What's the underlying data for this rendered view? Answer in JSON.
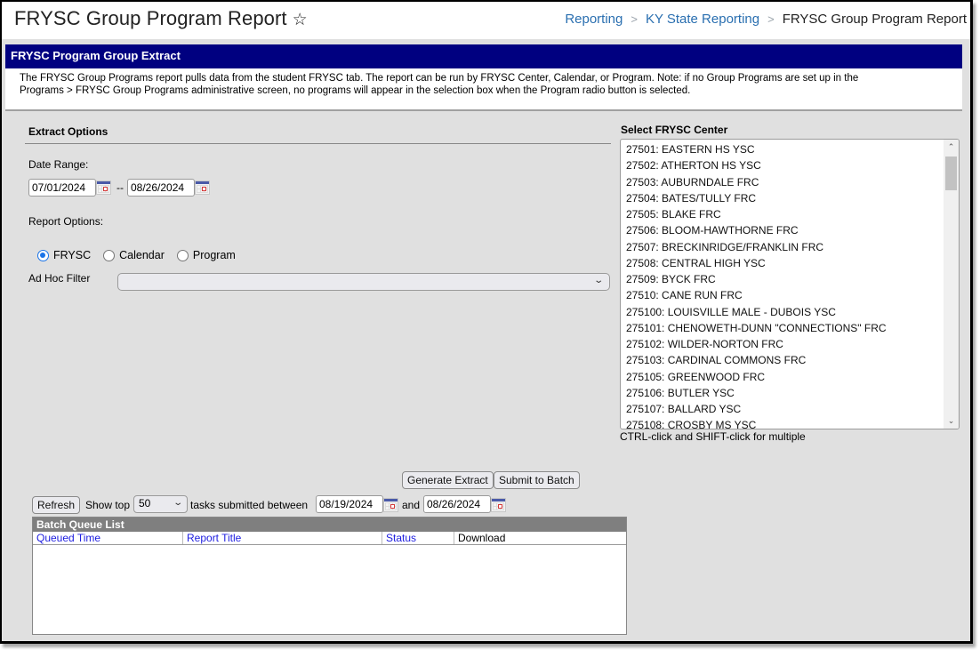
{
  "header": {
    "title": "FRYSC Group Program Report",
    "favorite_icon": "star-outline-icon",
    "breadcrumb": [
      {
        "label": "Reporting",
        "link": true
      },
      {
        "label": "KY State Reporting",
        "link": true
      },
      {
        "label": "FRYSC Group Program Report",
        "link": false
      }
    ],
    "breadcrumb_separator": ">"
  },
  "section": {
    "title": "FRYSC Program Group Extract",
    "description_line1": "The FRYSC Group Programs report pulls data from the student FRYSC tab. The report can be run by FRYSC Center, Calendar, or Program. Note: if no Group Programs are set up in the",
    "description_line2": "Programs > FRYSC Group Programs administrative screen, no programs will appear in the selection box when the Program radio button is selected."
  },
  "extract_options": {
    "title": "Extract Options",
    "date_range_label": "Date Range:",
    "start_date": "07/01/2024",
    "date_separator": "--",
    "end_date": "08/26/2024",
    "report_options_label": "Report Options:",
    "radios": [
      {
        "label": "FRYSC",
        "checked": true
      },
      {
        "label": "Calendar",
        "checked": false
      },
      {
        "label": "Program",
        "checked": false
      }
    ],
    "adhoc_label": "Ad Hoc Filter",
    "adhoc_value": ""
  },
  "center_select": {
    "title": "Select FRYSC Center",
    "items": [
      "27501: EASTERN HS YSC",
      "27502: ATHERTON HS YSC",
      "27503: AUBURNDALE FRC",
      "27504: BATES/TULLY FRC",
      "27505: BLAKE FRC",
      "27506: BLOOM-HAWTHORNE FRC",
      "27507: BRECKINRIDGE/FRANKLIN FRC",
      "27508: CENTRAL HIGH YSC",
      "27509: BYCK FRC",
      "27510: CANE RUN FRC",
      "275100: LOUISVILLE MALE - DUBOIS YSC",
      "275101: CHENOWETH-DUNN \"CONNECTIONS\" FRC",
      "275102: WILDER-NORTON FRC",
      "275103: CARDINAL COMMONS FRC",
      "275105: GREENWOOD FRC",
      "275106: BUTLER YSC",
      "275107: BALLARD YSC",
      "275108: CROSBY MS YSC"
    ],
    "hint": "CTRL-click and SHIFT-click for multiple"
  },
  "actions": {
    "generate": "Generate Extract",
    "submit_batch": "Submit to Batch"
  },
  "batch": {
    "refresh": "Refresh",
    "show_top_label": "Show top",
    "show_top_value": "50",
    "tasks_label": "tasks submitted between",
    "from_date": "08/19/2024",
    "and_label": "and",
    "to_date": "08/26/2024",
    "list_title": "Batch Queue List",
    "columns": [
      "Queued Time",
      "Report Title",
      "Status",
      "Download"
    ],
    "rows": []
  }
}
